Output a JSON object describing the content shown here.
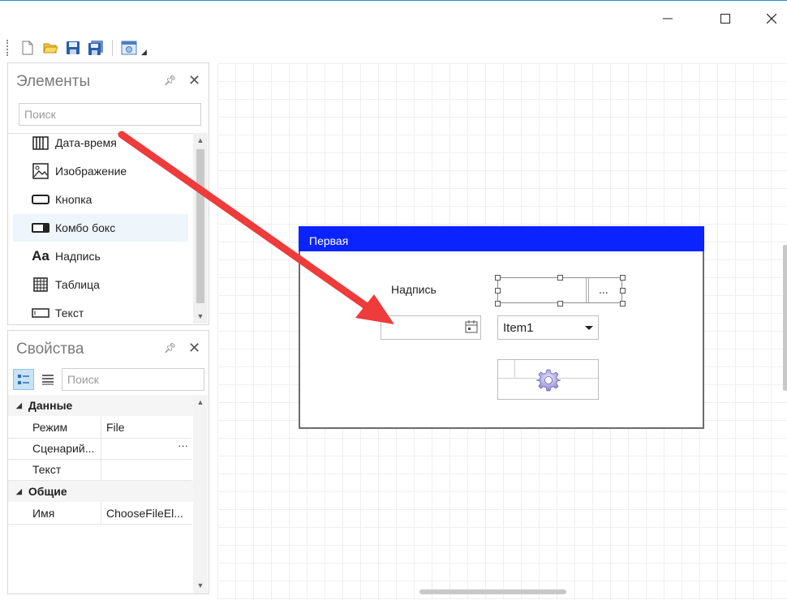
{
  "window": {
    "controls": [
      "minimize",
      "maximize",
      "close"
    ]
  },
  "toolbar": {
    "icons": [
      "new-document-icon",
      "open-folder-icon",
      "save-icon",
      "save-all-icon",
      "preview-icon"
    ]
  },
  "elements_panel": {
    "title": "Элементы",
    "search_placeholder": "Поиск",
    "items": [
      {
        "label": "Дата-время",
        "icon": "datetime-icon"
      },
      {
        "label": "Изображение",
        "icon": "image-icon"
      },
      {
        "label": "Кнопка",
        "icon": "button-icon"
      },
      {
        "label": "Комбо бокс",
        "icon": "combobox-icon",
        "selected": true
      },
      {
        "label": "Надпись",
        "icon": "label-icon",
        "glyph": "Aa"
      },
      {
        "label": "Таблица",
        "icon": "table-icon"
      },
      {
        "label": "Текст",
        "icon": "textbox-icon"
      }
    ]
  },
  "properties_panel": {
    "title": "Свойства",
    "search_placeholder": "Поиск",
    "categories": [
      {
        "name": "Данные",
        "rows": [
          {
            "name": "Режим",
            "value": "File"
          },
          {
            "name": "Сценарий...",
            "value": "",
            "more": "···"
          },
          {
            "name": "Текст",
            "value": ""
          }
        ]
      },
      {
        "name": "Общие",
        "rows": [
          {
            "name": "Имя",
            "value": "ChooseFileEl..."
          }
        ]
      }
    ]
  },
  "designer": {
    "form_title": "Первая",
    "label_text": "Надпись",
    "combo_value": "Item1",
    "file_button_text": "...",
    "title_bar_color": "#0a23ff",
    "annotation_arrow_color": "#ee3b3b"
  }
}
